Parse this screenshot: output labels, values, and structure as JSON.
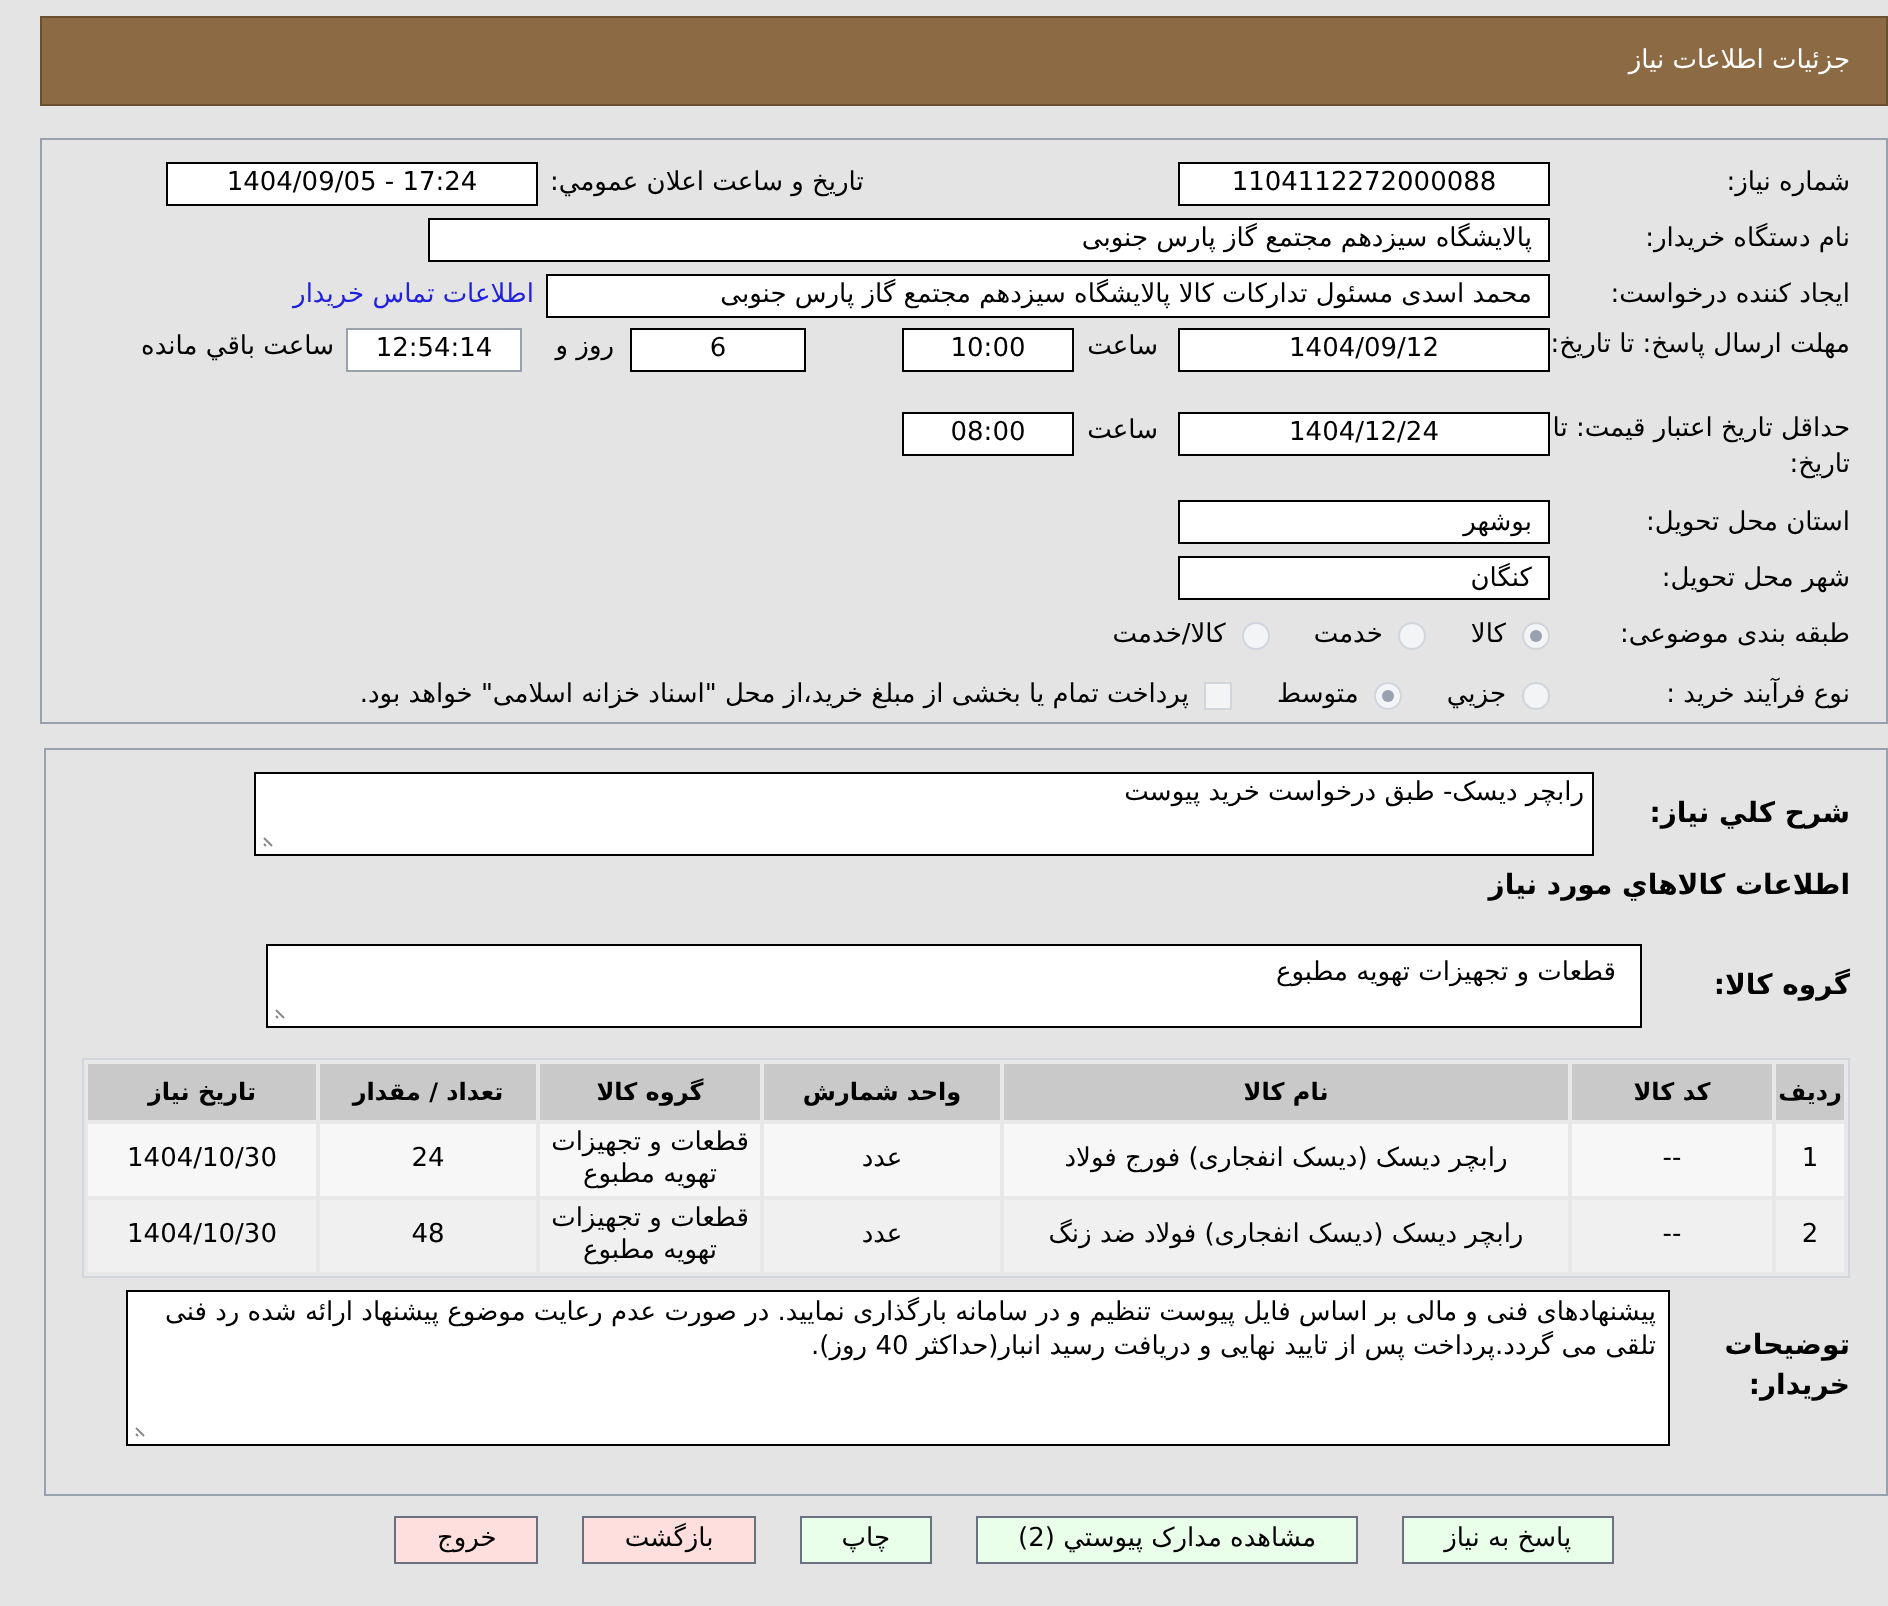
{
  "header": {
    "title": "جزئیات اطلاعات نیاز"
  },
  "need_number": {
    "label": "شماره نیاز:",
    "value": "1104112272000088"
  },
  "announce": {
    "label": "تاریخ و ساعت اعلان عمومي:",
    "value": "1404/09/05 - 17:24"
  },
  "buyer_org": {
    "label": "نام دستگاه خریدار:",
    "value": "پالایشگاه سیزدهم مجتمع گاز پارس جنوبی"
  },
  "requester": {
    "label": "ایجاد کننده درخواست:",
    "value": "محمد اسدی مسئول تدارکات کالا پالایشگاه سیزدهم مجتمع گاز پارس جنوبی",
    "link": "اطلاعات تماس خریدار"
  },
  "deadline": {
    "label": "مهلت ارسال پاسخ: تا تاریخ:",
    "date": "1404/09/12",
    "time_label": "ساعت",
    "time": "10:00",
    "days": "6",
    "days_label": "روز و",
    "remaining": "12:54:14",
    "remaining_label": "ساعت باقي مانده"
  },
  "validity": {
    "label": "حداقل تاریخ اعتبار قیمت: تا تاریخ:",
    "date": "1404/12/24",
    "time_label": "ساعت",
    "time": "08:00"
  },
  "province": {
    "label": "استان محل تحویل:",
    "value": "بوشهر"
  },
  "city": {
    "label": "شهر محل تحویل:",
    "value": "کنگان"
  },
  "category": {
    "label": "طبقه بندی موضوعی:",
    "options": [
      {
        "label": "کالا",
        "selected": true
      },
      {
        "label": "خدمت",
        "selected": false
      },
      {
        "label": "کالا/خدمت",
        "selected": false
      }
    ]
  },
  "process": {
    "label": "نوع فرآیند خرید :",
    "options": [
      {
        "label": "جزيي",
        "selected": false
      },
      {
        "label": "متوسط",
        "selected": true
      }
    ],
    "treasury": {
      "checked": false,
      "label": "پرداخت تمام یا بخشی از مبلغ خرید،از محل \"اسناد خزانه اسلامی\" خواهد بود."
    }
  },
  "general_description": {
    "label": "شرح کلي نیاز:",
    "value": "رابچر دیسک- طبق درخواست خرید پیوست"
  },
  "goods_info_title": "اطلاعات کالاهاي مورد نیاز",
  "goods_group": {
    "label": "گروه کالا:",
    "value": "قطعات و تجهیزات تهویه مطبوع"
  },
  "table": {
    "columns": [
      "ردیف",
      "کد کالا",
      "نام کالا",
      "واحد شمارش",
      "گروه کالا",
      "تعداد / مقدار",
      "تاریخ نیاز"
    ],
    "rows": [
      [
        "1",
        "--",
        "رابچر دیسک (دیسک انفجاری) فورج فولاد",
        "عدد",
        "قطعات و تجهیزات تهویه مطبوع",
        "24",
        "1404/10/30"
      ],
      [
        "2",
        "--",
        "رابچر دیسک (دیسک انفجاری) فولاد ضد زنگ",
        "عدد",
        "قطعات و تجهیزات تهویه مطبوع",
        "48",
        "1404/10/30"
      ]
    ]
  },
  "buyer_notes": {
    "label": "توضیحات خریدار:",
    "value": "پیشنهادهای فنی و مالی بر اساس فایل پیوست تنظیم و در سامانه بارگذاری نمایید. در صورت عدم رعایت موضوع پیشنهاد ارائه شده رد فنی تلقی می گردد.پرداخت پس از تایید نهایی و دریافت رسید انبار(حداکثر 40 روز)."
  },
  "buttons": [
    {
      "label": "پاسخ به نیاز",
      "kind": "green"
    },
    {
      "label": "مشاهده مدارک پیوستي (2)",
      "kind": "green"
    },
    {
      "label": "چاپ",
      "kind": "green"
    },
    {
      "label": "بازگشت",
      "kind": "pink"
    },
    {
      "label": "خروج",
      "kind": "pink"
    }
  ]
}
